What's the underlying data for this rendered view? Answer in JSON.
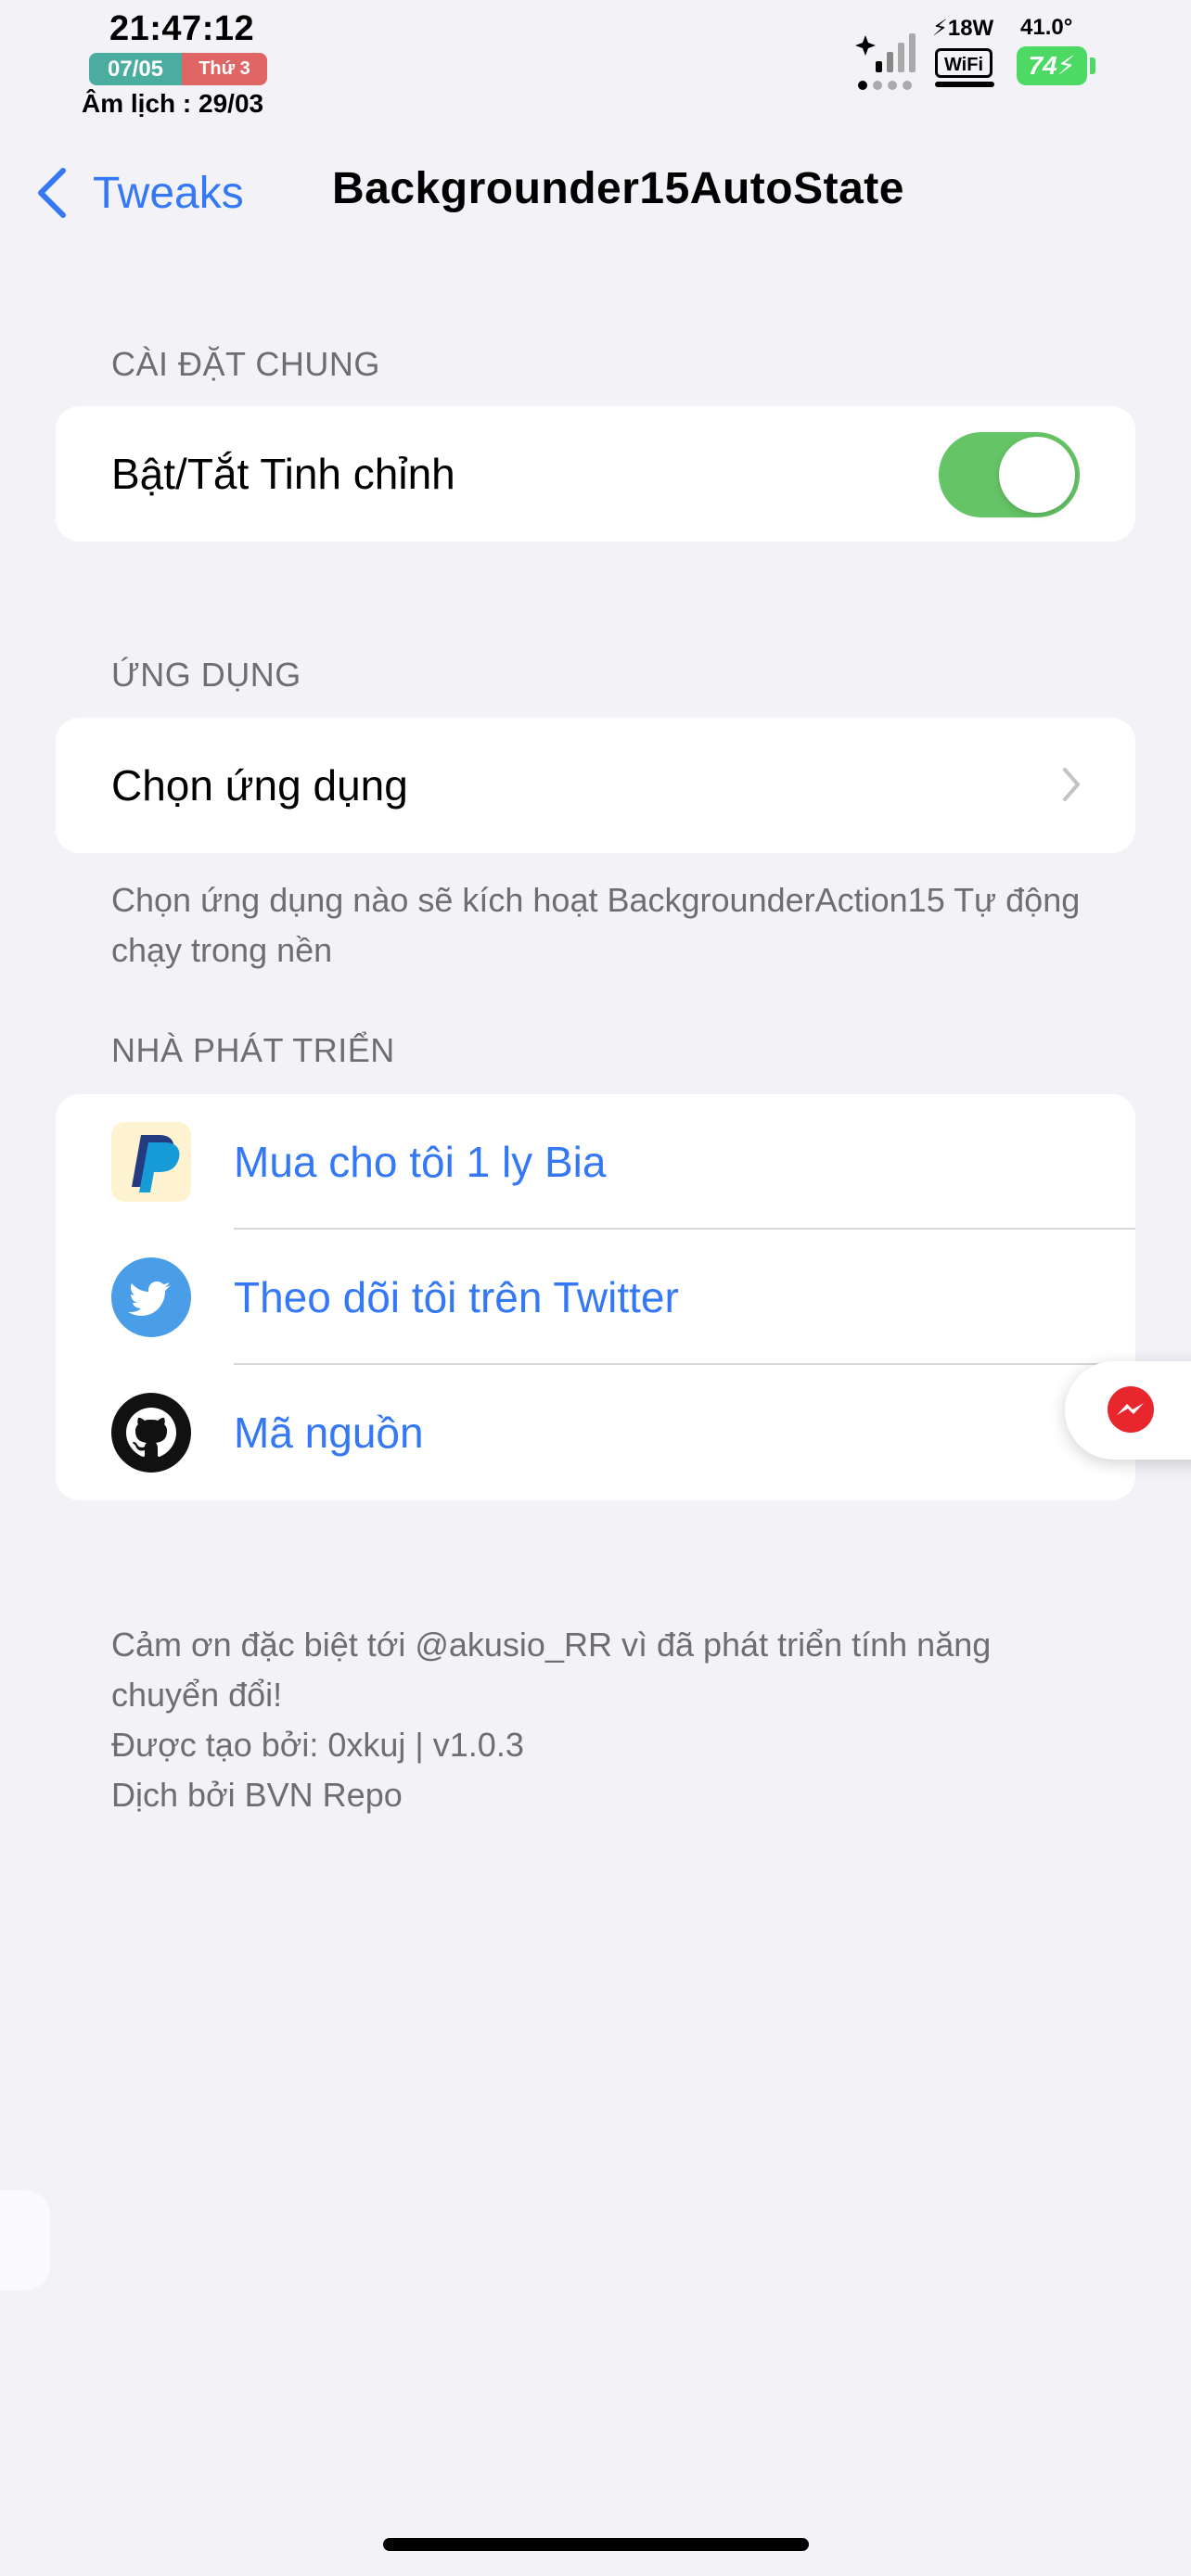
{
  "status_bar": {
    "time": "21:47:12",
    "date": "07/05",
    "weekday": "Thứ 3",
    "lunar": "Âm lịch : 29/03",
    "charging": "⚡18W",
    "temperature": "41.0°",
    "wifi": "WiFi",
    "battery": "74⚡"
  },
  "nav": {
    "back_label": "Tweaks",
    "title": "Backgrounder15AutoState"
  },
  "general": {
    "header": "CÀI ĐẶT CHUNG",
    "toggle_label": "Bật/Tắt Tinh chỉnh",
    "toggle_on": true
  },
  "apps": {
    "header": "ỨNG DỤNG",
    "select_label": "Chọn ứng dụng",
    "footnote": "Chọn ứng dụng nào sẽ kích hoạt BackgrounderAction15 Tự động chạy trong nền"
  },
  "developer": {
    "header": "NHÀ PHÁT TRIỂN",
    "items": [
      {
        "label": "Mua cho tôi 1 ly Bia",
        "icon": "paypal-icon"
      },
      {
        "label": "Theo dõi tôi trên Twitter",
        "icon": "twitter-icon"
      },
      {
        "label": "Mã nguồn",
        "icon": "github-icon"
      }
    ]
  },
  "footer": {
    "thanks": "Cảm ơn đặc biệt tới @akusio_RR vì đã phát triển tính năng chuyển đổi!",
    "created_by": "Được tạo bởi: 0xkuj | v1.0.3",
    "translated_by": "Dịch bởi BVN Repo"
  },
  "colors": {
    "accent": "#3478f6",
    "toggle_on": "#65c466",
    "background": "#f2f2f7"
  }
}
